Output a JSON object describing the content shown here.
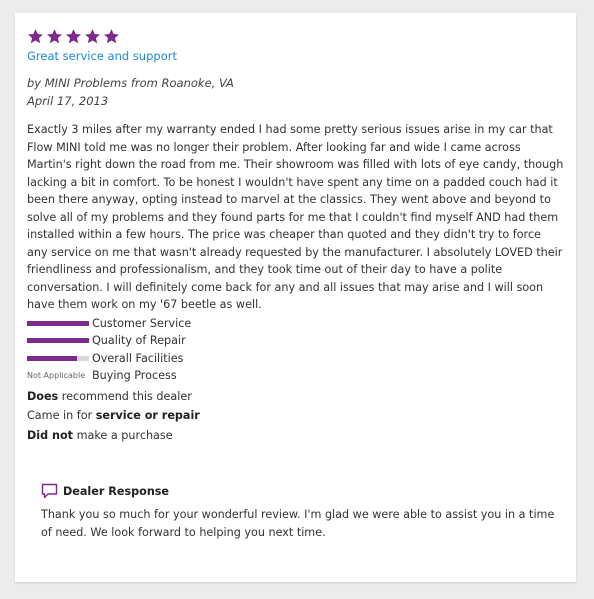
{
  "review": {
    "rating": 5,
    "max_rating": 5,
    "star_color": "#7c2a8c",
    "title": "Great service and support",
    "author": "by MINI Problems from Roanoke, VA",
    "date": "April 17, 2013",
    "body": "Exactly 3 miles after my warranty ended I had some pretty serious issues arise in my car that Flow MINI told me was no longer their problem. After looking far and wide I came across Martin's right down the road from me. Their showroom was filled with lots of eye candy, though lacking a bit in comfort. To be honest I wouldn't have spent any time on a padded couch had it been there anyway, opting instead to marvel at the classics. They went above and beyond to solve all of my problems and they found parts for me that I couldn't find myself AND had them installed within a few hours. The price was cheaper than quoted and they didn't try to force any service on me that wasn't already requested by the manufacturer. I absolutely LOVED their friendliness and professionalism, and they took time out of their day to have a polite conversation. I will definitely come back for any and all issues that may arise and I will soon have them work on my '67 beetle as well."
  },
  "ratings": [
    {
      "label": "Customer Service",
      "score": 5,
      "max": 5
    },
    {
      "label": "Quality of Repair",
      "score": 5,
      "max": 5
    },
    {
      "label": "Overall Facilities",
      "score": 4,
      "max": 5
    },
    {
      "label": "Buying Process",
      "not_applicable": "Not Applicable"
    }
  ],
  "facts": {
    "recommend_bold": "Does",
    "recommend_text": " recommend this dealer",
    "came_in_prefix": "Came in for ",
    "came_in_bold": "service or repair",
    "purchase_bold": "Did not",
    "purchase_text": " make a purchase"
  },
  "dealer_response": {
    "heading": "Dealer Response",
    "icon": "speech-bubble-icon",
    "text": "Thank you so much for your wonderful review. I'm glad we were able to assist you in a time of need. We look forward to helping you next time."
  }
}
